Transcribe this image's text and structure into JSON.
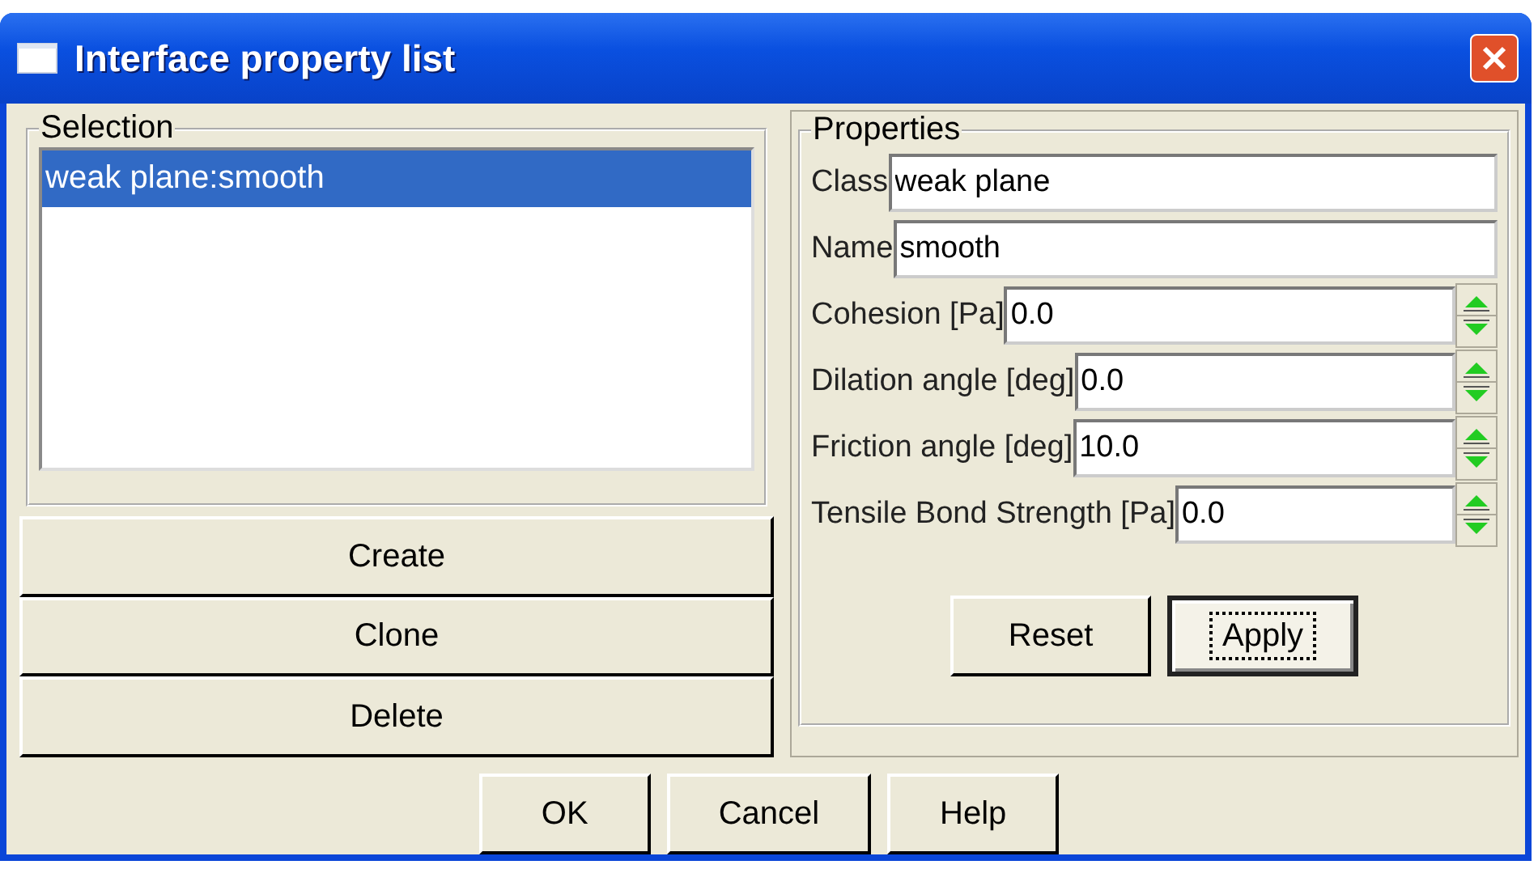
{
  "window": {
    "title": "Interface property list"
  },
  "selection": {
    "title": "Selection",
    "items": [
      {
        "label": "weak plane:smooth",
        "selected": true
      }
    ],
    "buttons": [
      {
        "label": "Create"
      },
      {
        "label": "Clone"
      },
      {
        "label": "Delete"
      }
    ]
  },
  "properties": {
    "title": "Properties",
    "fields": [
      {
        "kind": "text",
        "label": "Class",
        "value": "weak plane"
      },
      {
        "kind": "text",
        "label": "Name",
        "value": "smooth"
      },
      {
        "kind": "spin",
        "label": "Cohesion [Pa]",
        "value": "0.0"
      },
      {
        "kind": "spin",
        "label": "Dilation angle [deg]",
        "value": "0.0"
      },
      {
        "kind": "spin",
        "label": "Friction angle [deg]",
        "value": "10.0"
      },
      {
        "kind": "spin",
        "label": "Tensile Bond Strength [Pa]",
        "value": "0.0"
      }
    ],
    "buttons": [
      {
        "label": "Reset",
        "focused": false
      },
      {
        "label": "Apply",
        "focused": true
      }
    ]
  },
  "footer_buttons": [
    {
      "label": "OK"
    },
    {
      "label": "Cancel"
    },
    {
      "label": "Help"
    }
  ]
}
